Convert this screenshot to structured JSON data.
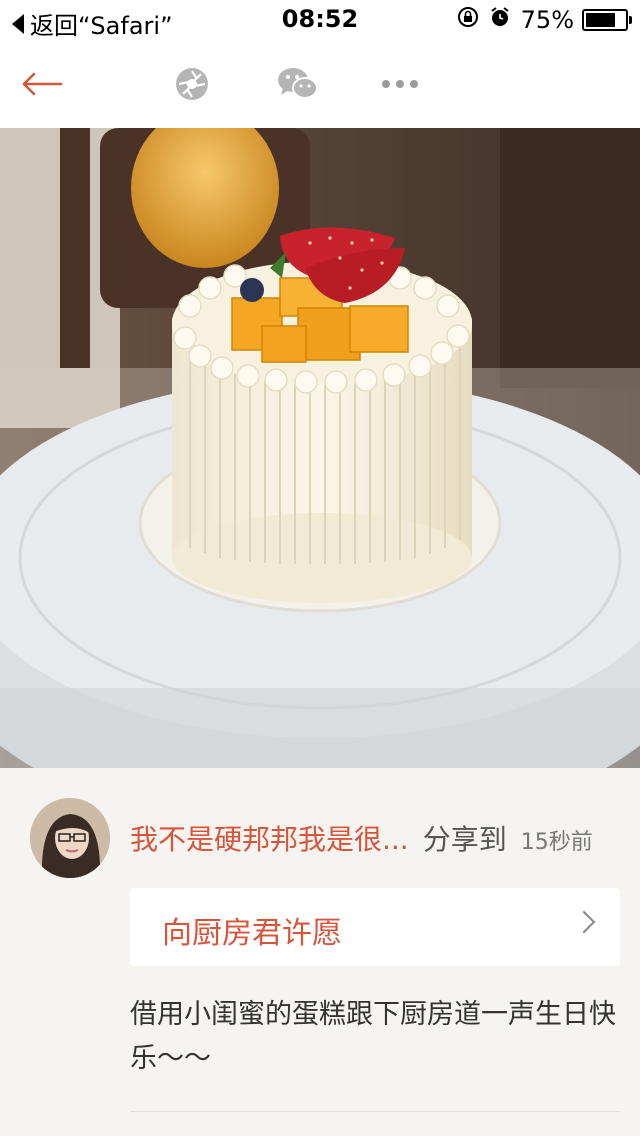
{
  "status_bar": {
    "back_label": "返回“Safari”",
    "time": "08:52",
    "battery_percent": "75%",
    "battery_level": 0.75,
    "icons": [
      "orientation-lock-icon",
      "alarm-icon",
      "battery-icon"
    ]
  },
  "toolbar": {
    "icons": [
      "back-arrow-icon",
      "moments-shutter-icon",
      "wechat-icon",
      "more-dots-icon"
    ],
    "accent": "#d7563b"
  },
  "post": {
    "photo": "cake-photo",
    "username": "我不是硬邦邦我是很...",
    "share_label": "分享到",
    "time_ago": "15秒前",
    "wish_title": "向厨房君许愿",
    "text": "借用小闺蜜的蛋糕跟下厨房道一声生日快乐～～"
  },
  "colors": {
    "accent": "#d7563b",
    "background": "#f5f4f0",
    "card": "#ffffff"
  }
}
